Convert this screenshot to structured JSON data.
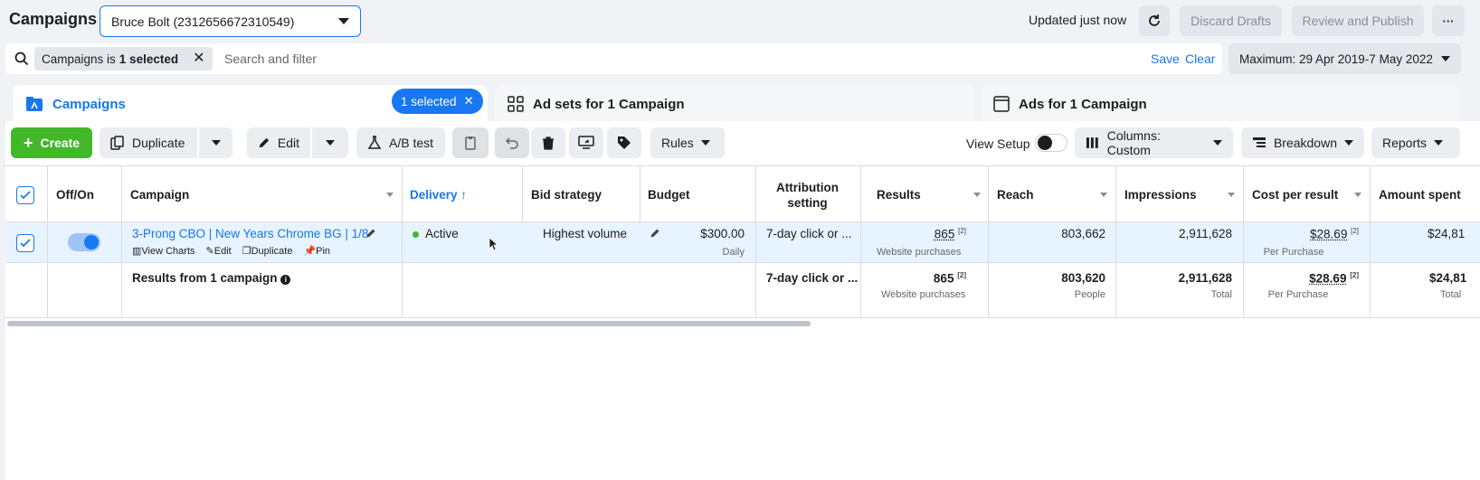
{
  "header": {
    "title": "Campaigns",
    "account": "Bruce Bolt (2312656672310549)",
    "updated": "Updated just now",
    "discard": "Discard Drafts",
    "review": "Review and Publish",
    "more": "···"
  },
  "filter": {
    "chip_prefix": "Campaigns is",
    "chip_value": "1 selected",
    "placeholder": "Search and filter",
    "save": "Save",
    "clear": "Clear",
    "date_range": "Maximum: 29 Apr 2019-7 May 2022"
  },
  "tabs": {
    "campaigns": "Campaigns",
    "selected_pill": "1 selected",
    "adsets": "Ad sets for 1 Campaign",
    "ads": "Ads for 1 Campaign"
  },
  "toolbar": {
    "create": "Create",
    "duplicate": "Duplicate",
    "edit": "Edit",
    "ab_test": "A/B test",
    "rules": "Rules",
    "view_setup": "View Setup",
    "columns": "Columns: Custom",
    "breakdown": "Breakdown",
    "reports": "Reports"
  },
  "columns": {
    "off_on": "Off/On",
    "campaign": "Campaign",
    "delivery": "Delivery ↑",
    "bid_strategy": "Bid strategy",
    "budget": "Budget",
    "attribution_1": "Attribution",
    "attribution_2": "setting",
    "results": "Results",
    "reach": "Reach",
    "impressions": "Impressions",
    "cost_per_result": "Cost per result",
    "amount_spent": "Amount spent"
  },
  "row": {
    "name": "3-Prong CBO | New Years Chrome BG | 1/8",
    "actions": {
      "view_charts": "View Charts",
      "edit": "Edit",
      "duplicate": "Duplicate",
      "pin": "Pin"
    },
    "delivery": "Active",
    "bid_strategy": "Highest volume",
    "budget": "$300.00",
    "budget_sub": "Daily",
    "attribution": "7-day click or ...",
    "results": "865",
    "results_sub": "Website purchases",
    "reach": "803,662",
    "impressions": "2,911,628",
    "cost_per_result": "$28.69",
    "cost_sub": "Per Purchase",
    "amount_spent": "$24,81"
  },
  "totals": {
    "label": "Results from 1 campaign",
    "attribution": "7-day click or ...",
    "results": "865",
    "results_sub": "Website purchases",
    "reach": "803,620",
    "reach_sub": "People",
    "impressions": "2,911,628",
    "impressions_sub": "Total",
    "cost_per_result": "$28.69",
    "cost_sub": "Per Purchase",
    "amount_spent": "$24,81",
    "amount_sub": "Total"
  },
  "colors": {
    "accent": "#1877f2",
    "create": "#42b72a",
    "selected_row": "#e7f3ff"
  }
}
